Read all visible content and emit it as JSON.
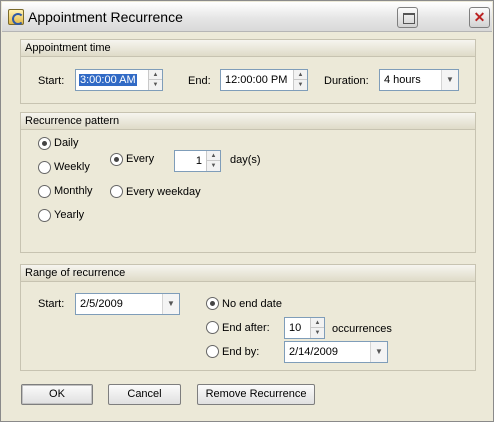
{
  "window": {
    "title": "Appointment Recurrence"
  },
  "appointment_time": {
    "header": "Appointment time",
    "start_label": "Start:",
    "start_value": "3:00:00 AM",
    "end_label": "End:",
    "end_value": "12:00:00 PM",
    "duration_label": "Duration:",
    "duration_value": "4 hours"
  },
  "recurrence_pattern": {
    "header": "Recurrence pattern",
    "types": [
      "Daily",
      "Weekly",
      "Monthly",
      "Yearly"
    ],
    "selected_type": "Daily",
    "every_label": "Every",
    "every_value": "1",
    "days_unit": "day(s)",
    "every_weekday_label": "Every weekday"
  },
  "range": {
    "header": "Range of recurrence",
    "start_label": "Start:",
    "start_value": "2/5/2009",
    "no_end_label": "No end date",
    "end_after_label": "End after:",
    "occurrences_value": "10",
    "occurrences_unit": "occurrences",
    "end_by_label": "End by:",
    "end_by_value": "2/14/2009"
  },
  "buttons": {
    "ok": "OK",
    "cancel": "Cancel",
    "remove": "Remove Recurrence"
  },
  "icons": {
    "app": "recurrence-icon",
    "maximize": "maximize-icon",
    "close": "close-icon"
  }
}
